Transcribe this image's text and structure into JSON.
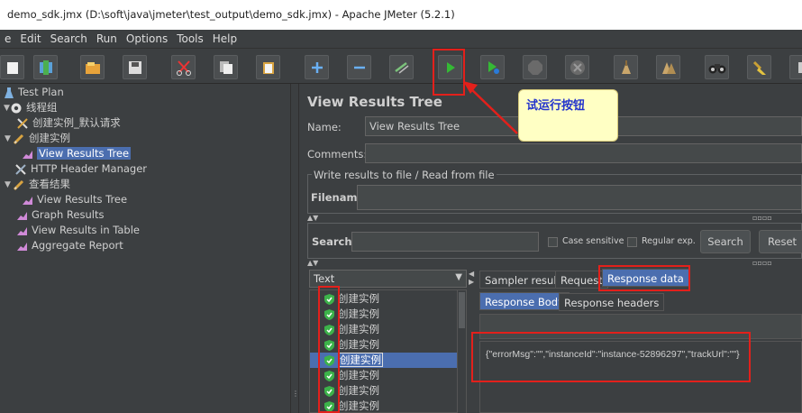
{
  "window": {
    "title": "demo_sdk.jmx (D:\\soft\\java\\jmeter\\test_output\\demo_sdk.jmx) - Apache JMeter (5.2.1)"
  },
  "menu": [
    "e",
    "Edit",
    "Search",
    "Run",
    "Options",
    "Tools",
    "Help"
  ],
  "toolbar": {
    "icons": [
      "new-icon",
      "templates-icon",
      "open-icon",
      "save-icon",
      "cut-icon",
      "copy-icon",
      "paste-icon",
      "expand-icon",
      "collapse-icon",
      "toggle-icon",
      "start-icon",
      "start-no-pause-icon",
      "stop-icon",
      "shutdown-icon",
      "clear-icon",
      "clear-all-icon",
      "search-icon",
      "reset-search-icon",
      "function-helper-icon"
    ]
  },
  "tree": {
    "items": [
      {
        "label": "Test Plan",
        "level": 0
      },
      {
        "label": "线程组",
        "level": 0
      },
      {
        "label": "创建实例_默认请求",
        "level": 1
      },
      {
        "label": "创建实例",
        "level": 1
      },
      {
        "label": "View Results Tree",
        "level": 2,
        "selected": true
      },
      {
        "label": "HTTP Header Manager",
        "level": 1
      },
      {
        "label": "查看结果",
        "level": 1
      },
      {
        "label": "View Results Tree",
        "level": 2
      },
      {
        "label": "Graph Results",
        "level": 1
      },
      {
        "label": "View Results in Table",
        "level": 1
      },
      {
        "label": "Aggregate Report",
        "level": 1
      }
    ]
  },
  "panel": {
    "title": "View Results Tree",
    "name_label": "Name:",
    "name_value": "View Results Tree",
    "comments_label": "Comments:",
    "write_group_label": "Write results to file / Read from file",
    "filename_label": "Filename",
    "search_label": "Search:",
    "case_sensitive": "Case sensitive",
    "regular_exp": "Regular exp.",
    "search_button": "Search",
    "reset_button": "Reset",
    "renderer_label": "Text",
    "result_tabs": [
      "Sampler result",
      "Request",
      "Response data"
    ],
    "response_subtabs": [
      "Response Body",
      "Response headers"
    ],
    "results": [
      "创建实例",
      "创建实例",
      "创建实例",
      "创建实例",
      "创建实例",
      "创建实例",
      "创建实例",
      "创建实例"
    ],
    "selected_result": 4,
    "response_body": "{\"errorMsg\":\"\",\"instanceId\":\"instance-52896297\",\"trackUrl\":\"\"}"
  },
  "annotation": {
    "callout": "试运行按钮"
  },
  "colors": {
    "highlight": "#e3201b",
    "selection": "#4b6eaf",
    "callout_bg": "#ffffc4",
    "callout_text": "#2233cc",
    "start_green": "#35b935"
  }
}
